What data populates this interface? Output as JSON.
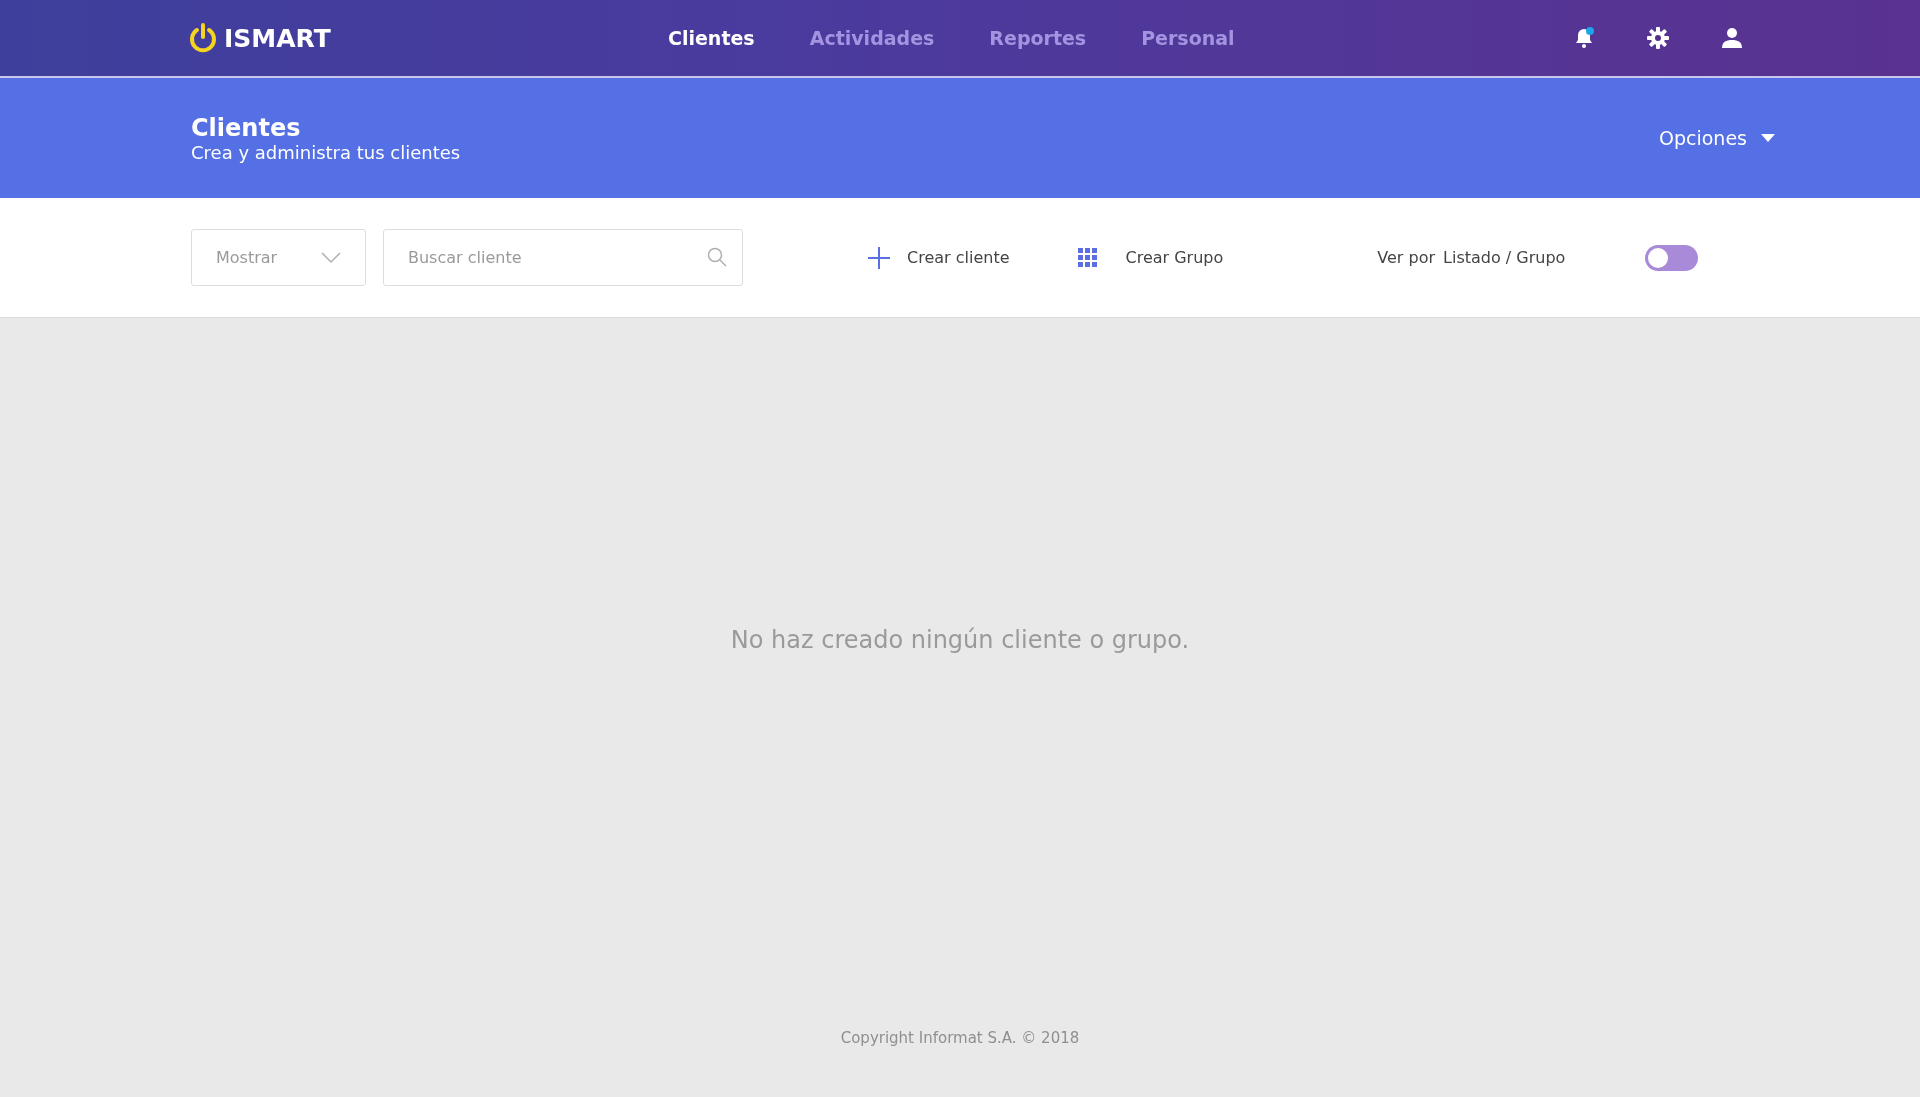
{
  "brand": {
    "name": "ISMART"
  },
  "nav": [
    {
      "label": "Clientes",
      "selected": true
    },
    {
      "label": "Actividades",
      "selected": false
    },
    {
      "label": "Reportes",
      "selected": false
    },
    {
      "label": "Personal",
      "selected": false
    }
  ],
  "notifications": {
    "unread": true
  },
  "header": {
    "title": "Clientes",
    "subtitle": "Crea y administra tus clientes",
    "options": "Opciones"
  },
  "toolbar": {
    "show_select": {
      "placeholder": "Mostrar"
    },
    "search": {
      "placeholder": "Buscar cliente"
    },
    "create_client": "Crear cliente",
    "create_group": "Crear Grupo",
    "view_label": "Ver por",
    "view_modes": "Listado / Grupo",
    "view_toggle": {
      "on": false
    }
  },
  "empty_message": "No haz creado ningún cliente o grupo.",
  "footer": "Copyright Informat S.A. © 2018"
}
